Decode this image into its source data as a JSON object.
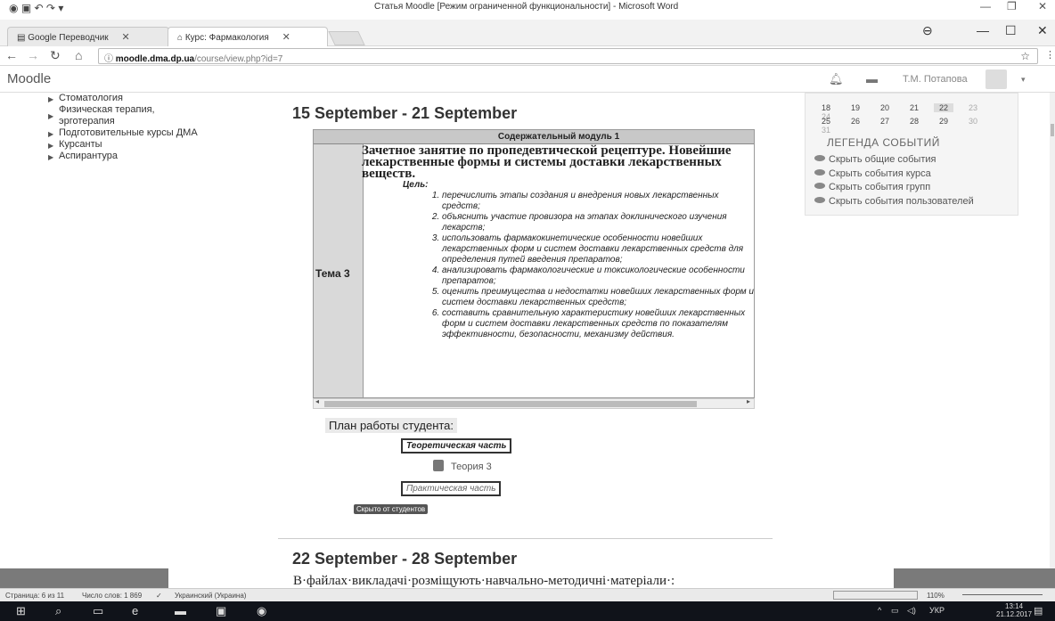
{
  "word_window": {
    "title": "Статья Moodle [Режим ограниченной функциональности] - Microsoft Word",
    "minimize": "—",
    "restore": "❐",
    "close": "✕"
  },
  "browser": {
    "tabs": [
      {
        "label": "Google Переводчик",
        "close": "✕"
      },
      {
        "label": "Курс: Фармакология",
        "close": "✕"
      }
    ],
    "profile_icon": "account-circle-icon",
    "minimize": "—",
    "maximize": "☐",
    "close": "✕",
    "url_host": "moodle.dma.dp.ua",
    "url_path": "/course/view.php?id=7",
    "info_icon": "ⓘ"
  },
  "moodle_header": {
    "brand": "Moodle",
    "user_name": "Т.М. Потапова"
  },
  "sidebar": {
    "categories": [
      "Стоматология",
      "Физическая терапия, эрготерапия",
      "Подготовительные курсы ДМА",
      "Курсанты",
      "Аспирантура"
    ]
  },
  "main": {
    "week1_title": "15 September - 21 September",
    "module_header": "Содержательный модуль 1",
    "topic_label": "Тема 3",
    "lesson_title": "Зачетное занятие по пропедевтической рецептуре. Новейшие лекарственные формы и системы доставки лекарственных веществ.",
    "goal_label": "Цель:",
    "objectives": [
      "перечислить этапы создания и внедрения новых лекарственных средств;",
      "объяснить участие провизора на этапах доклинического изучения лекарств;",
      "использовать фармакокинетические особенности новейших лекарственных форм и систем доставки лекарственных средств для определения путей введения препаратов;",
      "анализировать фармакологические и токсикологические особенности препаратов;",
      "оценить преимущества и недостатки новейших лекарственных форм и систем доставки лекарственных средств;",
      "составить сравнительную характеристику новейших лекарственных форм и систем доставки лекарственных средств по показателям эффективности, безопасности, механизму действия."
    ],
    "plan_label": "План работы студента:",
    "theory_box": "Теоретическая часть",
    "theory_link": "Теория 3",
    "practice_box": "Практическая часть",
    "hidden_badge": "Скрыто от студентов",
    "week2_title": "22 September - 28 September"
  },
  "calendar": {
    "row1": [
      "18",
      "19",
      "20",
      "21",
      "22",
      "23",
      "24"
    ],
    "row2": [
      "25",
      "26",
      "27",
      "28",
      "29",
      "30",
      "31"
    ],
    "today": "22",
    "legend_title": "ЛЕГЕНДА СОБЫТИЙ",
    "legend_items": [
      "Скрыть общие события",
      "Скрыть события курса",
      "Скрыть события групп",
      "Скрыть события пользователей"
    ]
  },
  "word_doc": {
    "body_text": "В·файлах·викладачі·розміщують·навчально-методичні·матеріали·:"
  },
  "status_bar": {
    "page": "Страница: 6 из 11",
    "words": "Число слов: 1 869",
    "language": "Украинский (Украина)",
    "zoom": "110%"
  },
  "taskbar": {
    "language": "УКР",
    "time": "13:14",
    "date": "21.12.2017"
  }
}
